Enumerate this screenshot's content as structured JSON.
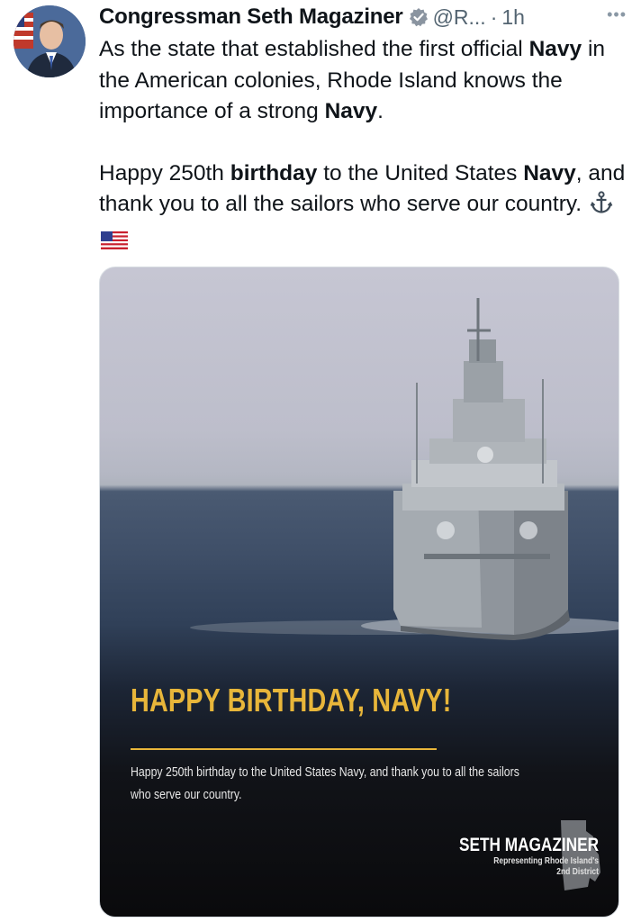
{
  "author": {
    "name": "Congressman Seth Magaziner",
    "handle": "@R...",
    "separator": "·",
    "time": "1h",
    "verified_icon": "verified-badge-icon",
    "more_icon": "more-icon"
  },
  "tweet": {
    "p1": [
      "As the state that established the first official ",
      "Navy",
      " in the American colonies, Rhode Island knows the importance of a strong ",
      "Navy",
      "."
    ],
    "p2": [
      "Happy 250th ",
      "birthday",
      " to the United States ",
      "Navy",
      ", and thank you to all the sailors who serve our country."
    ],
    "emojis": [
      "anchor-icon",
      "us-flag-icon"
    ]
  },
  "media": {
    "title": "HAPPY BIRTHDAY, NAVY!",
    "body": "Happy 250th birthday to the United States Navy, and thank you to all the sailors who serve our country.",
    "signature_name": "SETH MAGAZINER",
    "signature_line1": "Representing Rhode Island's",
    "signature_line2": "2nd District",
    "accent_color": "#e8b63a"
  }
}
